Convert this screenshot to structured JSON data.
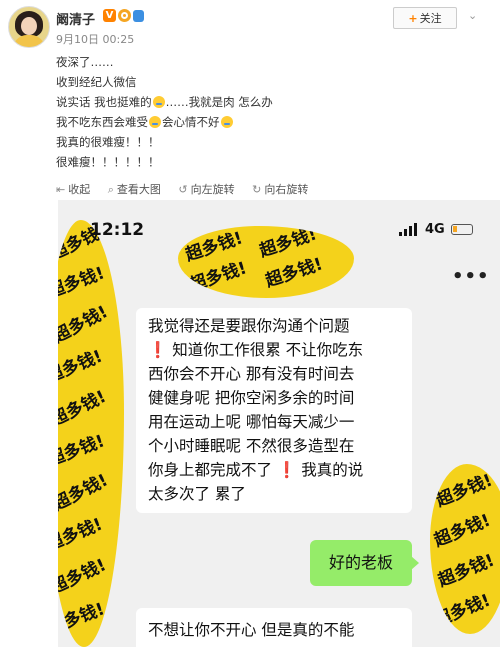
{
  "post": {
    "username": "阚清子",
    "verified_badge": "V",
    "date": "9月10日",
    "time": "00:25",
    "follow_label": "关注",
    "lines": [
      "夜深了……",
      "收到经纪人微信",
      "说实话 我也挺难的",
      "……我就是肉 怎么办",
      "我不吃东西会难受",
      "会心情不好",
      "我真的很难瘦！！！",
      "很难瘦！！！！！！"
    ]
  },
  "toolbar": {
    "collapse": "收起",
    "view_large": "查看大图",
    "rotate_left": "向左旋转",
    "rotate_right": "向右旋转"
  },
  "phone": {
    "time": "12:12",
    "network": "4G",
    "menu": "•••",
    "message1_lines": [
      "我觉得还是要跟你沟通个问题",
      "知道你工作很累 不让你吃东",
      "西你会不开心 那有没有时间去",
      "健健身呢 把你空闲多余的时间",
      "用在运动上呢 哪怕每天减少一",
      "个小时睡眠呢 不然很多造型在",
      "你身上都完成不了",
      "我真的说",
      "太多次了 累了"
    ],
    "reply": "好的老板",
    "message2_line": "不想让你不开心 但是真的不能"
  },
  "sticker_text": "超多钱!",
  "colors": {
    "accent": "#ff8200",
    "wechat_green": "#95ec69",
    "sticker_yellow": "#f4d21b",
    "alert_red": "#ee2222"
  }
}
